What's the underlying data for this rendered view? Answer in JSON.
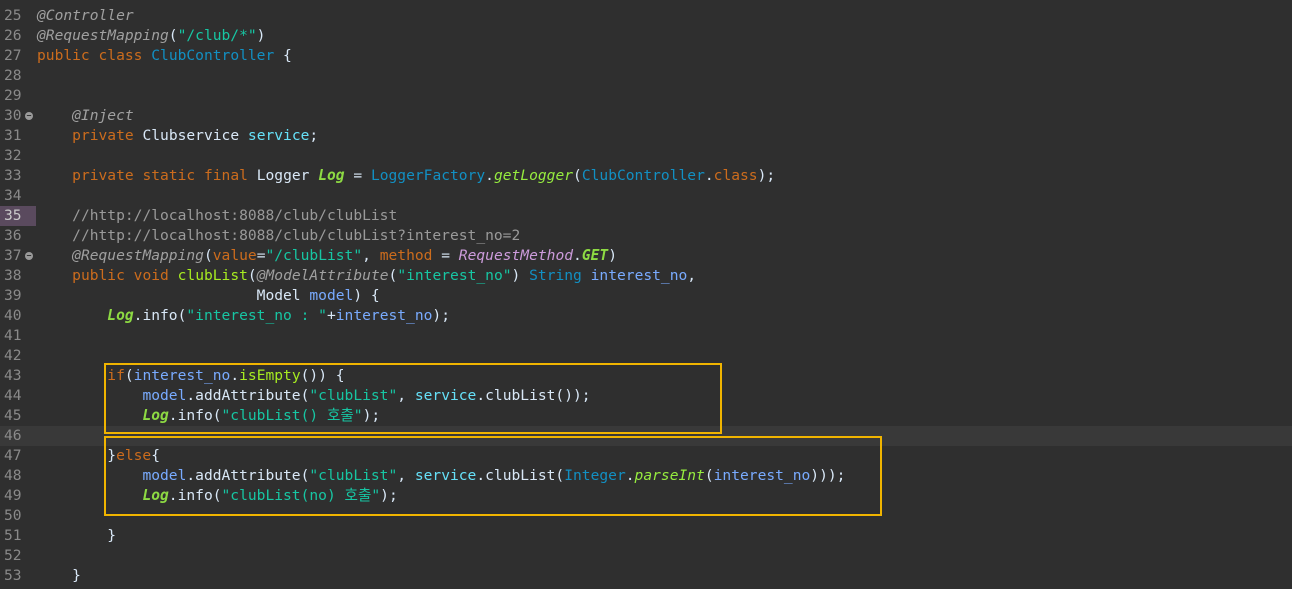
{
  "editor": {
    "lines": [
      {
        "num": "25",
        "tokens": [
          {
            "t": "@Controller",
            "c": "ann"
          }
        ]
      },
      {
        "num": "26",
        "tokens": [
          {
            "t": "@RequestMapping",
            "c": "ann"
          },
          {
            "t": "(",
            "c": "plain"
          },
          {
            "t": "\"/club/*\"",
            "c": "str"
          },
          {
            "t": ")",
            "c": "plain"
          }
        ]
      },
      {
        "num": "27",
        "tokens": [
          {
            "t": "public",
            "c": "kw"
          },
          {
            "t": " ",
            "c": "plain"
          },
          {
            "t": "class",
            "c": "kw"
          },
          {
            "t": " ",
            "c": "plain"
          },
          {
            "t": "ClubController",
            "c": "cls"
          },
          {
            "t": " {",
            "c": "plain"
          }
        ]
      },
      {
        "num": "28",
        "tokens": []
      },
      {
        "num": "29",
        "tokens": []
      },
      {
        "num": "30",
        "fold": true,
        "tokens": [
          {
            "t": "    ",
            "c": "plain"
          },
          {
            "t": "@Inject",
            "c": "ann"
          }
        ]
      },
      {
        "num": "31",
        "tokens": [
          {
            "t": "    ",
            "c": "plain"
          },
          {
            "t": "private",
            "c": "kw"
          },
          {
            "t": " Clubservice ",
            "c": "plain"
          },
          {
            "t": "service",
            "c": "field"
          },
          {
            "t": ";",
            "c": "plain"
          }
        ]
      },
      {
        "num": "32",
        "tokens": []
      },
      {
        "num": "33",
        "tokens": [
          {
            "t": "    ",
            "c": "plain"
          },
          {
            "t": "private",
            "c": "kw"
          },
          {
            "t": " ",
            "c": "plain"
          },
          {
            "t": "static",
            "c": "kw"
          },
          {
            "t": " ",
            "c": "plain"
          },
          {
            "t": "final",
            "c": "kw"
          },
          {
            "t": " Logger ",
            "c": "plain"
          },
          {
            "t": "Log",
            "c": "static"
          },
          {
            "t": " = ",
            "c": "plain"
          },
          {
            "t": "LoggerFactory",
            "c": "cls"
          },
          {
            "t": ".",
            "c": "plain"
          },
          {
            "t": "getLogger",
            "c": "smethod"
          },
          {
            "t": "(",
            "c": "plain"
          },
          {
            "t": "ClubController",
            "c": "cls"
          },
          {
            "t": ".",
            "c": "plain"
          },
          {
            "t": "class",
            "c": "kw"
          },
          {
            "t": ");",
            "c": "plain"
          }
        ]
      },
      {
        "num": "34",
        "tokens": []
      },
      {
        "num": "35",
        "marked": true,
        "tokens": [
          {
            "t": "    ",
            "c": "plain"
          },
          {
            "t": "//http://localhost:8088/club/clubList",
            "c": "cmt"
          }
        ]
      },
      {
        "num": "36",
        "tokens": [
          {
            "t": "    ",
            "c": "plain"
          },
          {
            "t": "//http://localhost:8088/club/clubList?interest_no=2",
            "c": "cmt"
          }
        ]
      },
      {
        "num": "37",
        "fold": true,
        "tokens": [
          {
            "t": "    ",
            "c": "plain"
          },
          {
            "t": "@RequestMapping",
            "c": "ann"
          },
          {
            "t": "(",
            "c": "plain"
          },
          {
            "t": "value",
            "c": "attr"
          },
          {
            "t": "=",
            "c": "plain"
          },
          {
            "t": "\"/clubList\"",
            "c": "str"
          },
          {
            "t": ", ",
            "c": "plain"
          },
          {
            "t": "method",
            "c": "attr"
          },
          {
            "t": " = ",
            "c": "plain"
          },
          {
            "t": "RequestMethod",
            "c": "enum"
          },
          {
            "t": ".",
            "c": "plain"
          },
          {
            "t": "GET",
            "c": "enumc"
          },
          {
            "t": ")",
            "c": "plain"
          }
        ]
      },
      {
        "num": "38",
        "tokens": [
          {
            "t": "    ",
            "c": "plain"
          },
          {
            "t": "public",
            "c": "kw"
          },
          {
            "t": " ",
            "c": "plain"
          },
          {
            "t": "void",
            "c": "kw"
          },
          {
            "t": " ",
            "c": "plain"
          },
          {
            "t": "clubList",
            "c": "method"
          },
          {
            "t": "(",
            "c": "plain"
          },
          {
            "t": "@ModelAttribute",
            "c": "ann"
          },
          {
            "t": "(",
            "c": "plain"
          },
          {
            "t": "\"interest_no\"",
            "c": "str"
          },
          {
            "t": ") ",
            "c": "plain"
          },
          {
            "t": "String",
            "c": "type"
          },
          {
            "t": " ",
            "c": "plain"
          },
          {
            "t": "interest_no",
            "c": "param"
          },
          {
            "t": ",",
            "c": "plain"
          }
        ]
      },
      {
        "num": "39",
        "tokens": [
          {
            "t": "                         Model ",
            "c": "plain"
          },
          {
            "t": "model",
            "c": "param"
          },
          {
            "t": ") {",
            "c": "plain"
          }
        ]
      },
      {
        "num": "40",
        "tokens": [
          {
            "t": "        ",
            "c": "plain"
          },
          {
            "t": "Log",
            "c": "static"
          },
          {
            "t": ".info(",
            "c": "plain"
          },
          {
            "t": "\"interest_no : \"",
            "c": "str"
          },
          {
            "t": "+",
            "c": "plain"
          },
          {
            "t": "interest_no",
            "c": "param"
          },
          {
            "t": ");",
            "c": "plain"
          }
        ]
      },
      {
        "num": "41",
        "tokens": []
      },
      {
        "num": "42",
        "tokens": []
      },
      {
        "num": "43",
        "tokens": [
          {
            "t": "        ",
            "c": "plain"
          },
          {
            "t": "if",
            "c": "kw"
          },
          {
            "t": "(",
            "c": "plain"
          },
          {
            "t": "interest_no",
            "c": "param"
          },
          {
            "t": ".",
            "c": "plain"
          },
          {
            "t": "isEmpty",
            "c": "method"
          },
          {
            "t": "()) {",
            "c": "plain"
          }
        ]
      },
      {
        "num": "44",
        "tokens": [
          {
            "t": "            ",
            "c": "plain"
          },
          {
            "t": "model",
            "c": "param"
          },
          {
            "t": ".addAttribute(",
            "c": "plain"
          },
          {
            "t": "\"clubList\"",
            "c": "str"
          },
          {
            "t": ", ",
            "c": "plain"
          },
          {
            "t": "service",
            "c": "field"
          },
          {
            "t": ".clubList());",
            "c": "plain"
          }
        ]
      },
      {
        "num": "45",
        "tokens": [
          {
            "t": "            ",
            "c": "plain"
          },
          {
            "t": "Log",
            "c": "static"
          },
          {
            "t": ".info(",
            "c": "plain"
          },
          {
            "t": "\"clubList() 호출\"",
            "c": "str"
          },
          {
            "t": ");",
            "c": "plain"
          }
        ]
      },
      {
        "num": "46",
        "current": true,
        "tokens": []
      },
      {
        "num": "47",
        "tokens": [
          {
            "t": "        }",
            "c": "plain"
          },
          {
            "t": "else",
            "c": "kw"
          },
          {
            "t": "{",
            "c": "plain"
          }
        ]
      },
      {
        "num": "48",
        "tokens": [
          {
            "t": "            ",
            "c": "plain"
          },
          {
            "t": "model",
            "c": "param"
          },
          {
            "t": ".addAttribute(",
            "c": "plain"
          },
          {
            "t": "\"clubList\"",
            "c": "str"
          },
          {
            "t": ", ",
            "c": "plain"
          },
          {
            "t": "service",
            "c": "field"
          },
          {
            "t": ".clubList(",
            "c": "plain"
          },
          {
            "t": "Integer",
            "c": "cls"
          },
          {
            "t": ".",
            "c": "plain"
          },
          {
            "t": "parseInt",
            "c": "smethod"
          },
          {
            "t": "(",
            "c": "plain"
          },
          {
            "t": "interest_no",
            "c": "param"
          },
          {
            "t": ")));",
            "c": "plain"
          }
        ]
      },
      {
        "num": "49",
        "tokens": [
          {
            "t": "            ",
            "c": "plain"
          },
          {
            "t": "Log",
            "c": "static"
          },
          {
            "t": ".info(",
            "c": "plain"
          },
          {
            "t": "\"clubList(no) 호출\"",
            "c": "str"
          },
          {
            "t": ");",
            "c": "plain"
          }
        ]
      },
      {
        "num": "50",
        "tokens": []
      },
      {
        "num": "51",
        "tokens": [
          {
            "t": "        }",
            "c": "plain"
          }
        ]
      },
      {
        "num": "52",
        "tokens": []
      },
      {
        "num": "53",
        "tokens": [
          {
            "t": "    }",
            "c": "plain"
          }
        ]
      }
    ],
    "highlight_color": "#f0b400"
  }
}
